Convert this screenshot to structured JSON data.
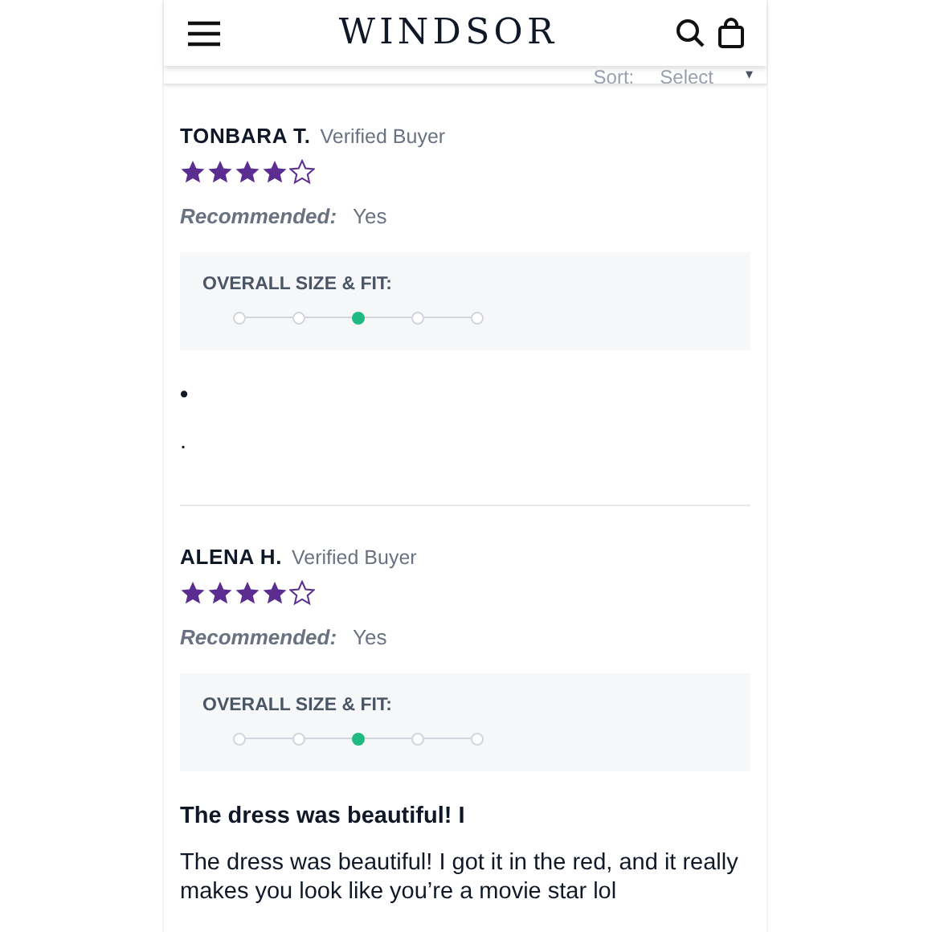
{
  "header": {
    "logo": "WINDSOR"
  },
  "sort": {
    "label": "Sort:",
    "value": "Select",
    "caret": "▾"
  },
  "reviews": [
    {
      "name": "TONBARA T.",
      "badge": "Verified Buyer",
      "stars": 4,
      "recommended_label": "Recommended:",
      "recommended_value": "Yes",
      "fit_label": "OVERALL SIZE & FIT:",
      "fit_scale": [
        {
          "selected": false
        },
        {
          "selected": false
        },
        {
          "selected": true
        },
        {
          "selected": false
        },
        {
          "selected": false
        }
      ],
      "title": "•",
      "body": "."
    },
    {
      "name": "ALENA H.",
      "badge": "Verified Buyer",
      "stars": 4,
      "recommended_label": "Recommended:",
      "recommended_value": "Yes",
      "fit_label": "OVERALL SIZE & FIT:",
      "fit_scale": [
        {
          "selected": false
        },
        {
          "selected": false
        },
        {
          "selected": true
        },
        {
          "selected": false
        },
        {
          "selected": false
        }
      ],
      "title": "The dress was beautiful! I",
      "body": "The dress was beautiful! I got it in the red, and it really makes you look like you’re a movie star lol"
    }
  ]
}
